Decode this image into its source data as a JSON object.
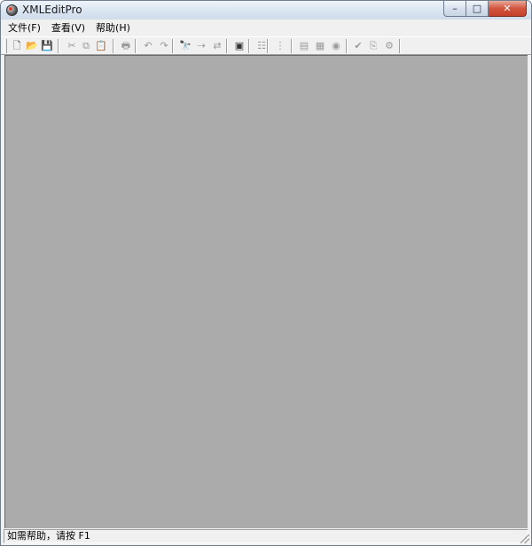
{
  "window": {
    "title": "XMLEditPro"
  },
  "window_controls": {
    "minimize": "–",
    "maximize": "□",
    "close": "✕"
  },
  "menu": {
    "items": [
      {
        "label": "文件(F)"
      },
      {
        "label": "查看(V)"
      },
      {
        "label": "帮助(H)"
      }
    ]
  },
  "toolbar": {
    "buttons": [
      {
        "name": "new-icon",
        "glyph": "🗋",
        "enabled": true
      },
      {
        "name": "open-folder-icon",
        "glyph": "📂",
        "enabled": true
      },
      {
        "name": "save-icon",
        "glyph": "💾",
        "enabled": false
      },
      {
        "name": "cut-icon",
        "glyph": "✂",
        "enabled": false
      },
      {
        "name": "copy-icon",
        "glyph": "⧉",
        "enabled": false
      },
      {
        "name": "paste-icon",
        "glyph": "📋",
        "enabled": false
      },
      {
        "name": "print-icon",
        "glyph": "🖶",
        "enabled": false
      },
      {
        "name": "undo-icon",
        "glyph": "↶",
        "enabled": false
      },
      {
        "name": "redo-icon",
        "glyph": "↷",
        "enabled": false
      },
      {
        "name": "find-icon",
        "glyph": "🔭",
        "enabled": false
      },
      {
        "name": "find-next-icon",
        "glyph": "⇢",
        "enabled": false
      },
      {
        "name": "replace-icon",
        "glyph": "⇄",
        "enabled": false
      },
      {
        "name": "window-icon",
        "glyph": "▣",
        "enabled": true
      },
      {
        "name": "tree-view-icon",
        "glyph": "☷",
        "enabled": false
      },
      {
        "name": "list-view-icon",
        "glyph": "⋮",
        "enabled": false
      },
      {
        "name": "xml-view-icon",
        "glyph": "▤",
        "enabled": false
      },
      {
        "name": "table-view-icon",
        "glyph": "▦",
        "enabled": false
      },
      {
        "name": "validate-icon",
        "glyph": "◉",
        "enabled": false
      },
      {
        "name": "check-icon",
        "glyph": "✔",
        "enabled": false
      },
      {
        "name": "transform-icon",
        "glyph": "⎘",
        "enabled": false
      },
      {
        "name": "tools-icon",
        "glyph": "⚙",
        "enabled": false
      }
    ]
  },
  "status": {
    "text": "如需帮助，请按 F1"
  }
}
